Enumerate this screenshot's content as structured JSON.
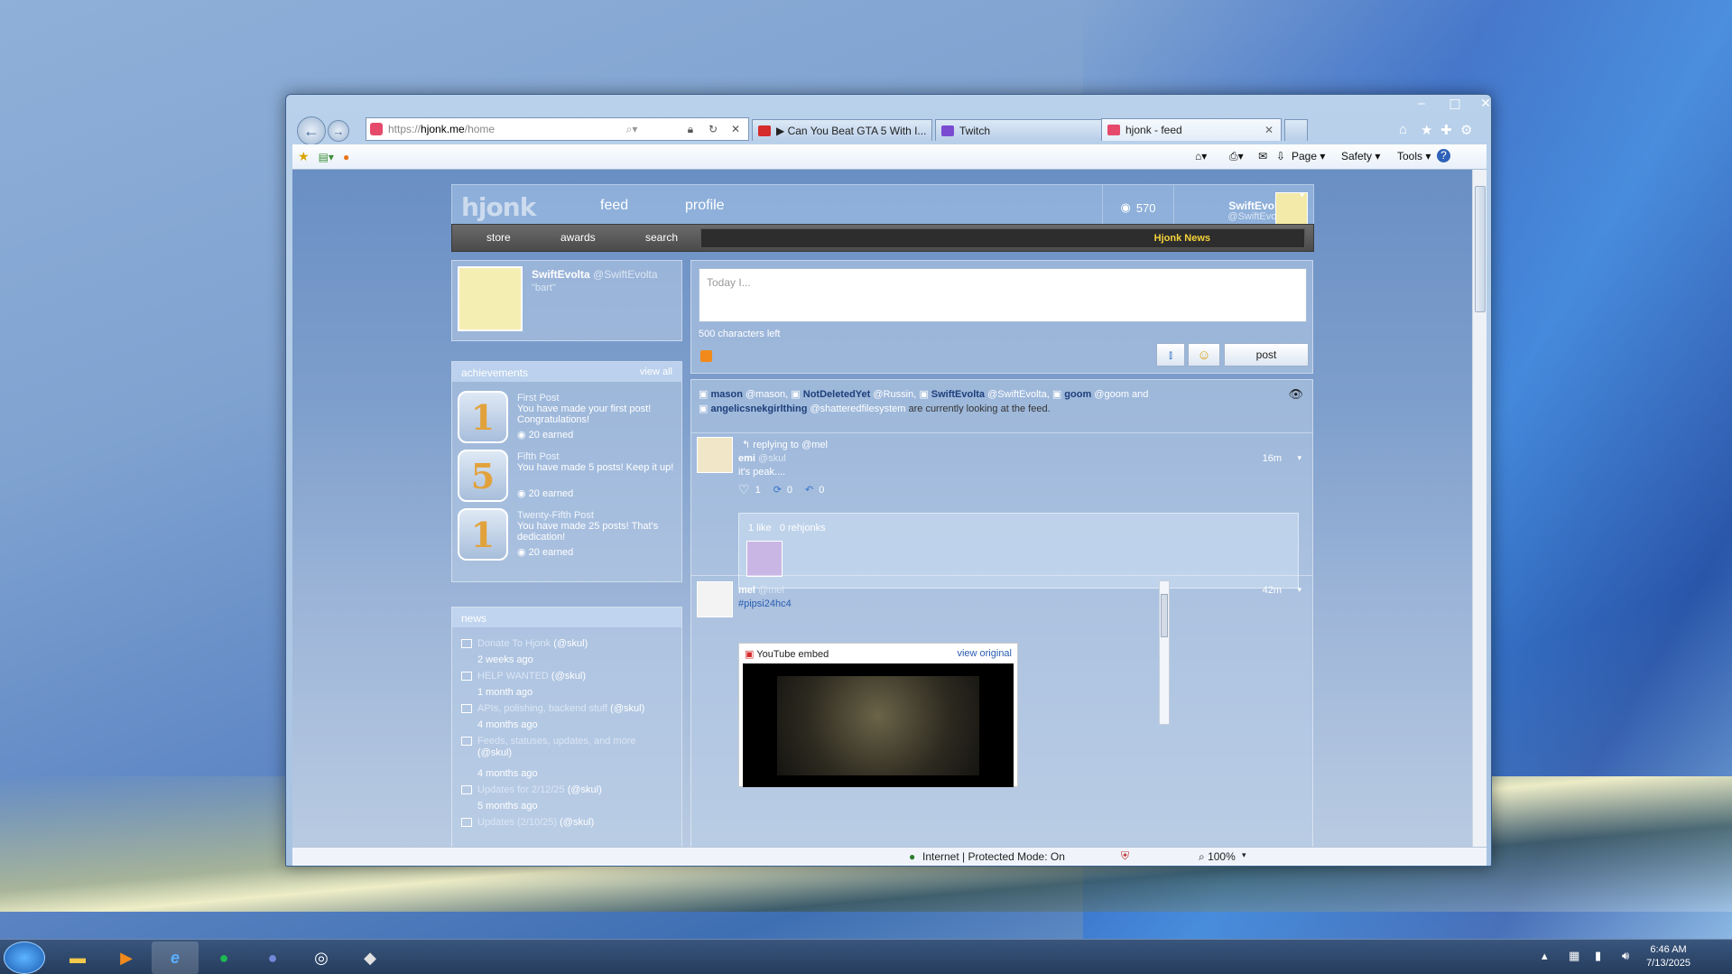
{
  "browser": {
    "url_prefix": "https://",
    "url_host": "hjonk.me",
    "url_path": "/home",
    "tabs": [
      {
        "label": "▶ Can You Beat GTA 5 With I...",
        "color": "#d52b2b"
      },
      {
        "label": "Twitch",
        "color": "#7a4bd1"
      },
      {
        "label": "hjonk - feed",
        "color": "#e64a6b"
      }
    ],
    "command_bar": {
      "page": "Page ▾",
      "safety": "Safety ▾",
      "tools": "Tools ▾",
      "help": "?"
    },
    "status": {
      "zone": "Internet | Protected Mode: On",
      "zoom": "100%"
    }
  },
  "site": {
    "logo": "hjonk",
    "nav": {
      "feed": "feed",
      "profile": "profile"
    },
    "coins": "570",
    "user": {
      "name": "SwiftEvolta",
      "handle": "@SwiftEvolta",
      "status": "\"bart\""
    },
    "subnav": {
      "store": "store",
      "awards": "awards",
      "search": "search"
    },
    "ticker": "Hjonk News"
  },
  "achievements": {
    "title": "achievements",
    "view_all": "view all",
    "items": [
      {
        "badge": "1",
        "title": "First Post",
        "desc": "You have made your first post! Congratulations!",
        "earned": "20 earned"
      },
      {
        "badge": "5",
        "title": "Fifth Post",
        "desc": "You have made 5 posts! Keep it up!",
        "earned": "20 earned"
      },
      {
        "badge": "1",
        "title": "Twenty-Fifth Post",
        "desc": "You have made 25 posts! That's dedication!",
        "earned": "20 earned"
      }
    ]
  },
  "news": {
    "title": "news",
    "items": [
      {
        "title": "Donate To Hjonk",
        "author": "(@skul)",
        "date": "2 weeks ago"
      },
      {
        "title": "HELP WANTED",
        "author": "(@skul)",
        "date": "1 month ago"
      },
      {
        "title": "APIs, polishing, backend stuff",
        "author": "(@skul)",
        "date": "4 months ago"
      },
      {
        "title": "Feeds, statuses, updates, and more",
        "author": "(@skul)",
        "date": "4 months ago"
      },
      {
        "title": "Updates for 2/12/25",
        "author": "(@skul)",
        "date": "5 months ago"
      },
      {
        "title": "Updates (2/10/25)",
        "author": "(@skul)",
        "date": ""
      }
    ]
  },
  "compose": {
    "placeholder": "Today I...",
    "chars_left": "500 characters left",
    "post": "post"
  },
  "watchers": {
    "users": [
      {
        "name": "mason",
        "handle": "@mason"
      },
      {
        "name": "NotDeletedYet",
        "handle": "@Russin"
      },
      {
        "name": "SwiftEvolta",
        "handle": "@SwiftEvolta"
      },
      {
        "name": "goom",
        "handle": "@goom"
      },
      {
        "name": "angelicsnekgirlthing",
        "handle": "@shatteredfilesystem"
      }
    ],
    "and": "and",
    "suffix": "are currently looking at the feed."
  },
  "posts": [
    {
      "reply": "replying to @mel",
      "name": "emi",
      "handle": "@skul",
      "time": "16m",
      "text": "it's peak....",
      "likes": "1",
      "rehjonks": "0",
      "replies": "0",
      "like_summary": "1 like",
      "rehjonk_summary": "0 rehjonks"
    },
    {
      "name": "mel",
      "handle": "@mel",
      "time": "42m",
      "text": "#pipsi24hc4",
      "embed_label": "YouTube embed",
      "embed_link": "view original"
    }
  ],
  "taskbar": {
    "time": "6:46 AM",
    "date": "7/13/2025"
  }
}
